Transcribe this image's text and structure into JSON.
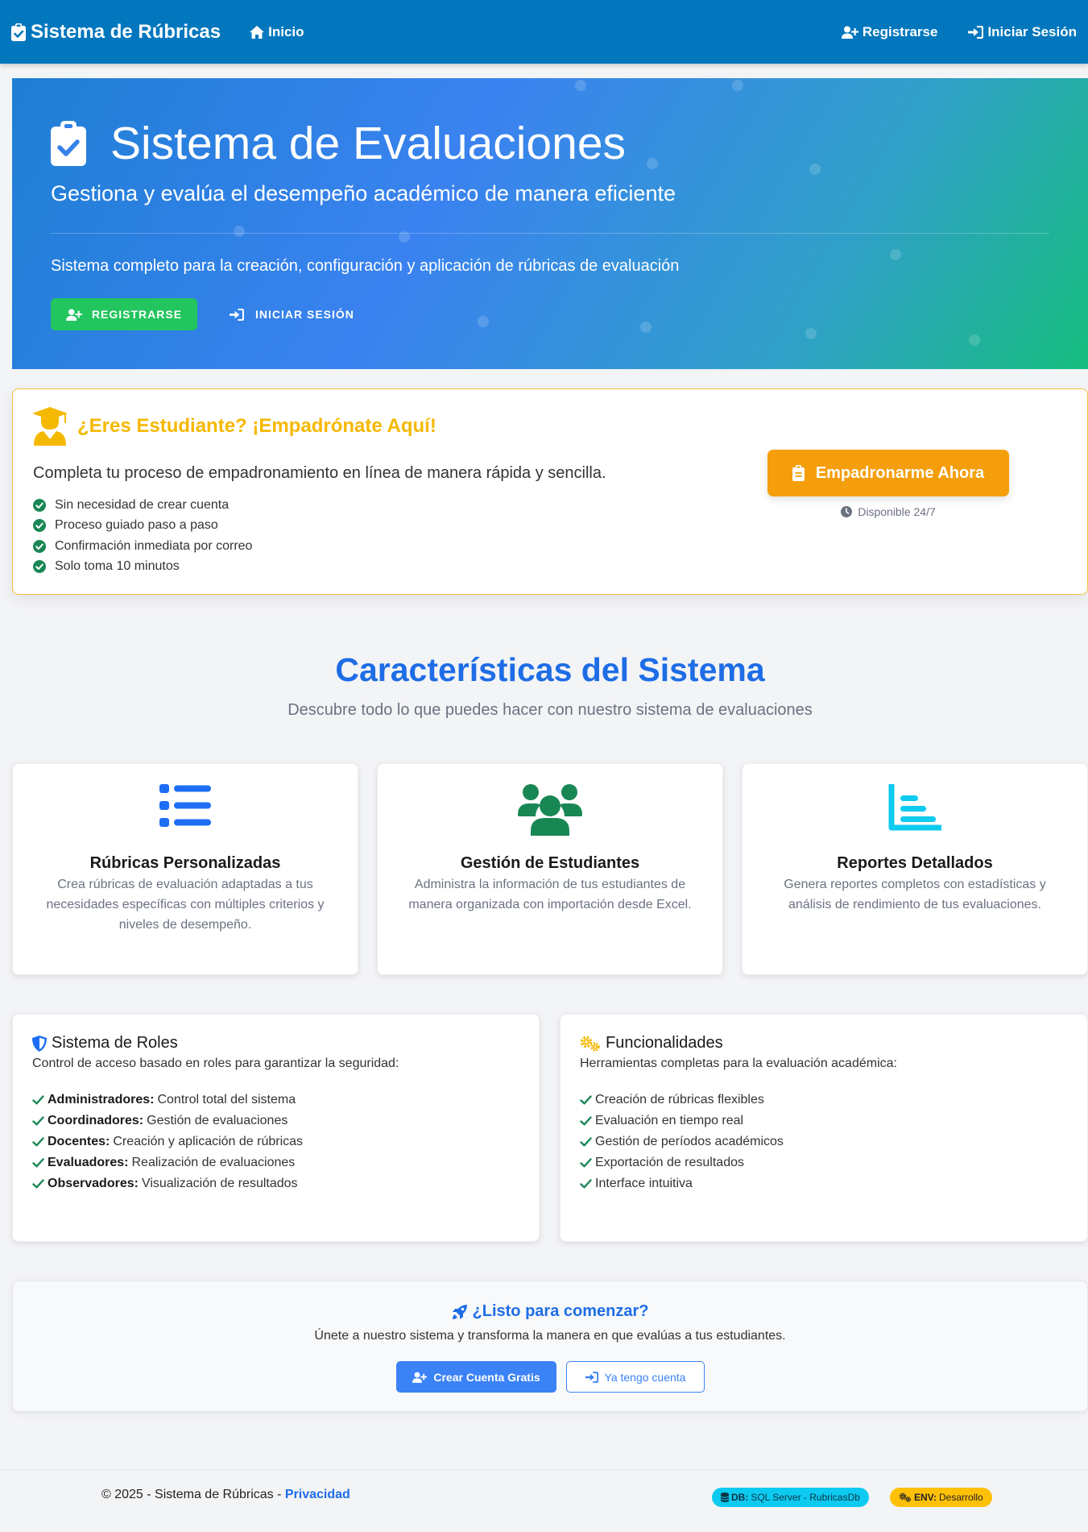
{
  "navbar": {
    "brand": "Sistema de Rúbricas",
    "home": "Inicio",
    "register": "Registrarse",
    "login": "Iniciar Sesión"
  },
  "hero": {
    "title": "Sistema de Evaluaciones",
    "subtitle": "Gestiona y evalúa el desempeño académico de manera eficiente",
    "description": "Sistema completo para la creación, configuración y aplicación de rúbricas de evaluación",
    "register_button": "REGISTRARSE",
    "login_button": "INICIAR SESIÓN"
  },
  "student": {
    "title": "¿Eres Estudiante? ¡Empadrónate Aquí!",
    "description": "Completa tu proceso de empadronamiento en línea de manera rápida y sencilla.",
    "items": [
      "Sin necesidad de crear cuenta",
      "Proceso guiado paso a paso",
      "Confirmación inmediata por correo",
      "Solo toma 10 minutos"
    ],
    "button": "Empadronarme Ahora",
    "availability": "Disponible 24/7"
  },
  "features": {
    "title": "Características del Sistema",
    "subtitle": "Descubre todo lo que puedes hacer con nuestro sistema de evaluaciones",
    "cards": [
      {
        "title": "Rúbricas Personalizadas",
        "text": "Crea rúbricas de evaluación adaptadas a tus necesidades específicas con múltiples criterios y niveles de desempeño.",
        "icon": "list-icon"
      },
      {
        "title": "Gestión de Estudiantes",
        "text": "Administra la información de tus estudiantes de manera organizada con importación desde Excel.",
        "icon": "users-icon"
      },
      {
        "title": "Reportes Detallados",
        "text": "Genera reportes completos con estadísticas y análisis de rendimiento de tus evaluaciones.",
        "icon": "chart-bar-icon"
      }
    ]
  },
  "roles": {
    "title": "Sistema de Roles",
    "description": "Control de acceso basado en roles para garantizar la seguridad:",
    "items": [
      {
        "role": "Administradores:",
        "desc": "Control total del sistema"
      },
      {
        "role": "Coordinadores:",
        "desc": "Gestión de evaluaciones"
      },
      {
        "role": "Docentes:",
        "desc": "Creación y aplicación de rúbricas"
      },
      {
        "role": "Evaluadores:",
        "desc": "Realización de evaluaciones"
      },
      {
        "role": "Observadores:",
        "desc": "Visualización de resultados"
      }
    ]
  },
  "functions": {
    "title": "Funcionalidades",
    "description": "Herramientas completas para la evaluación académica:",
    "items": [
      "Creación de rúbricas flexibles",
      "Evaluación en tiempo real",
      "Gestión de períodos académicos",
      "Exportación de resultados",
      "Interface intuitiva"
    ]
  },
  "cta": {
    "title": "¿Listo para comenzar?",
    "description": "Únete a nuestro sistema y transforma la manera en que evalúas a tus estudiantes.",
    "primary_button": "Crear Cuenta Gratis",
    "secondary_button": "Ya tengo cuenta"
  },
  "footer": {
    "copyright": "© 2025 - Sistema de Rúbricas - ",
    "privacy": "Privacidad",
    "db_label": "DB:",
    "db_value": "SQL Server - RubricasDb",
    "env_label": "ENV:",
    "env_value": "Desarrollo"
  },
  "colors": {
    "navbar": "#0277bd",
    "accent_blue": "#1e6de6",
    "green": "#22c55e",
    "orange": "#f59e0b",
    "student_title": "#f5b800",
    "check_green": "#198754"
  }
}
